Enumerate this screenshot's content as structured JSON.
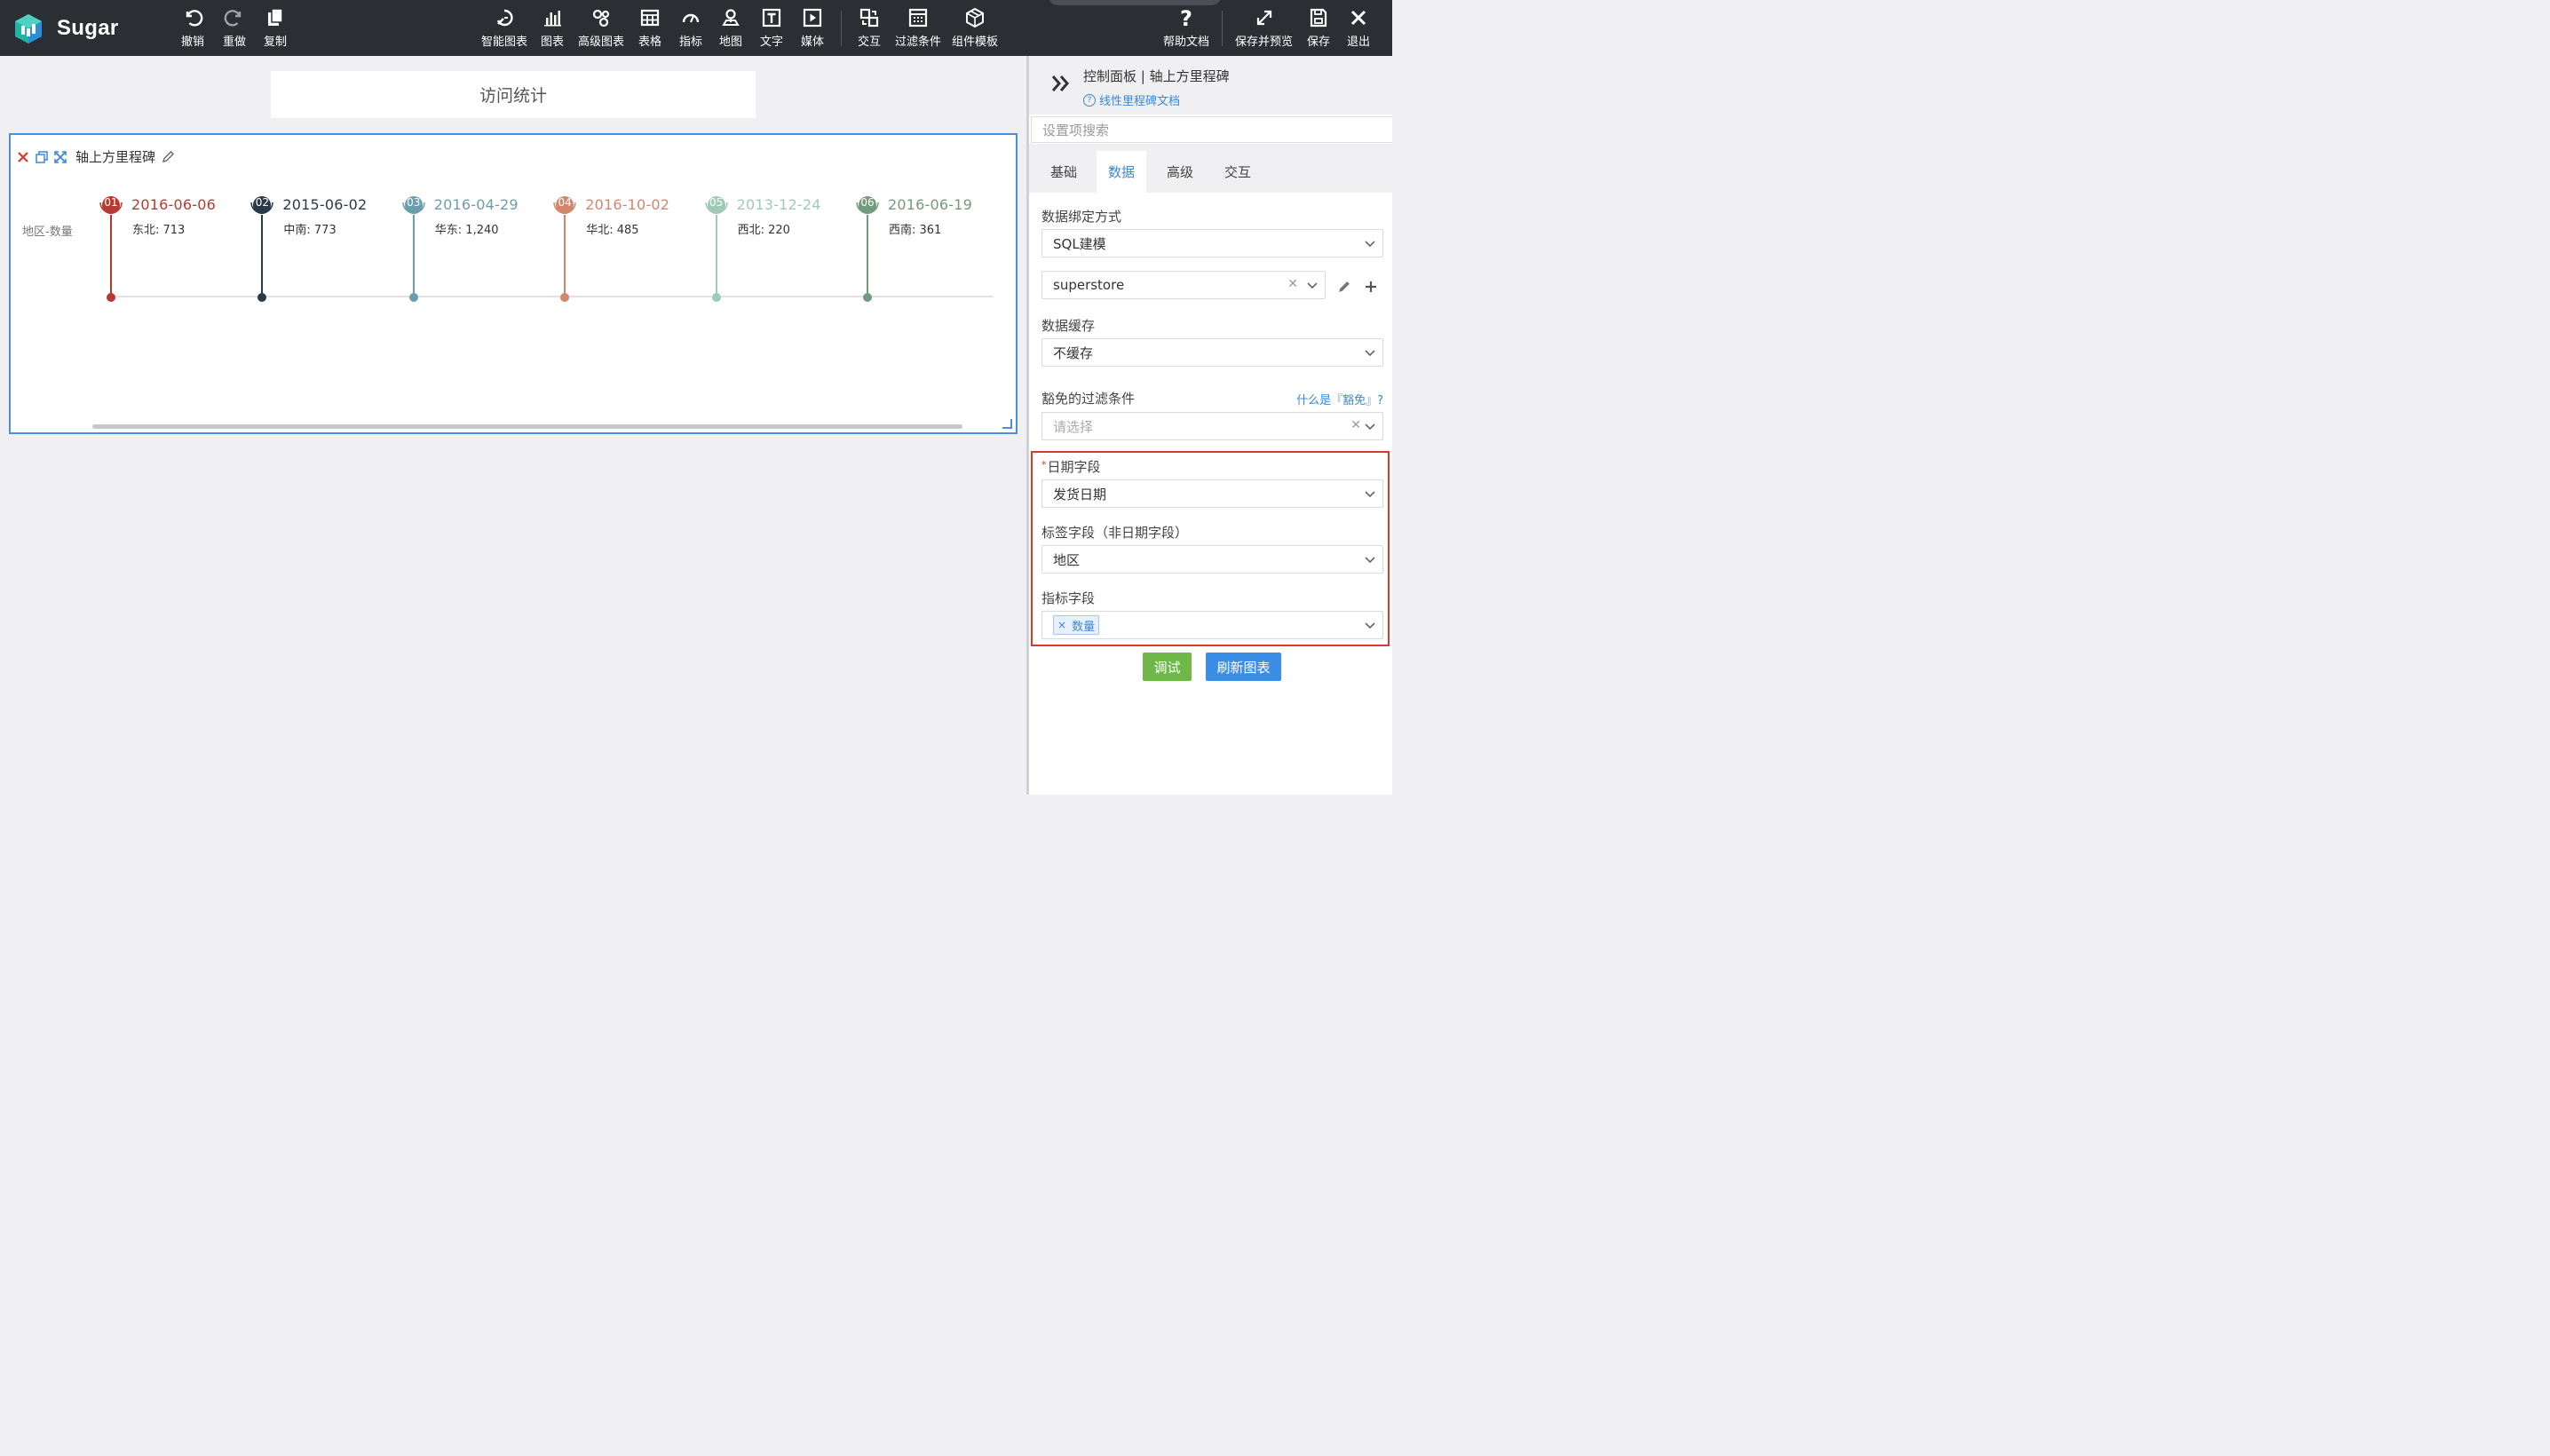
{
  "app": {
    "name": "Sugar"
  },
  "toolbar": {
    "undo": "撤销",
    "redo": "重做",
    "copy": "复制",
    "smart_chart": "智能图表",
    "chart": "图表",
    "advanced_chart": "高级图表",
    "table": "表格",
    "indicator": "指标",
    "map": "地图",
    "text": "文字",
    "media": "媒体",
    "interaction": "交互",
    "filter": "过滤条件",
    "component_template": "组件模板",
    "help": "帮助文档",
    "save_preview": "保存并预览",
    "save": "保存",
    "exit": "退出"
  },
  "canvas": {
    "page_title": "访问统计",
    "widget_title": "轴上方里程碑",
    "side_label": "地区-数量"
  },
  "chart_data": {
    "type": "timeline",
    "milestones": [
      {
        "index": "01",
        "date": "2016-06-06",
        "label": "东北: 713",
        "region": "东北",
        "value": 713,
        "color": "#b63a33"
      },
      {
        "index": "02",
        "date": "2015-06-02",
        "label": "中南: 773",
        "region": "中南",
        "value": 773,
        "color": "#2b3847"
      },
      {
        "index": "03",
        "date": "2016-04-29",
        "label": "华东: 1,240",
        "region": "华东",
        "value": 1240,
        "color": "#6b9ead"
      },
      {
        "index": "04",
        "date": "2016-10-02",
        "label": "华北: 485",
        "region": "华北",
        "value": 485,
        "color": "#d2866c"
      },
      {
        "index": "05",
        "date": "2013-12-24",
        "label": "西北: 220",
        "region": "西北",
        "value": 220,
        "color": "#9fcab6"
      },
      {
        "index": "06",
        "date": "2016-06-19",
        "label": "西南: 361",
        "region": "西南",
        "value": 361,
        "color": "#739a7c"
      }
    ]
  },
  "panel": {
    "title": "控制面板 | 轴上方里程碑",
    "doc_link": "线性里程碑文档",
    "search_placeholder": "设置项搜索",
    "tabs": {
      "basic": "基础",
      "data": "数据",
      "advanced": "高级",
      "interaction": "交互"
    },
    "binding_label": "数据绑定方式",
    "binding_value": "SQL建模",
    "datasource_value": "superstore",
    "cache_label": "数据缓存",
    "cache_value": "不缓存",
    "filter_label": "豁免的过滤条件",
    "filter_help": "什么是『豁免』?",
    "filter_placeholder": "请选择",
    "date_field_label": "日期字段",
    "date_field_value": "发货日期",
    "tag_field_label": "标签字段（非日期字段）",
    "tag_field_value": "地区",
    "metric_field_label": "指标字段",
    "metric_tag": "数量",
    "debug_button": "调试",
    "refresh_button": "刷新图表"
  },
  "colors": {
    "toolbar_bg": "#2b2e33",
    "accent_blue": "#3b87d6",
    "debug_green": "#6db847",
    "refresh_blue": "#3b8ee6",
    "highlight_red": "#e0372b"
  }
}
